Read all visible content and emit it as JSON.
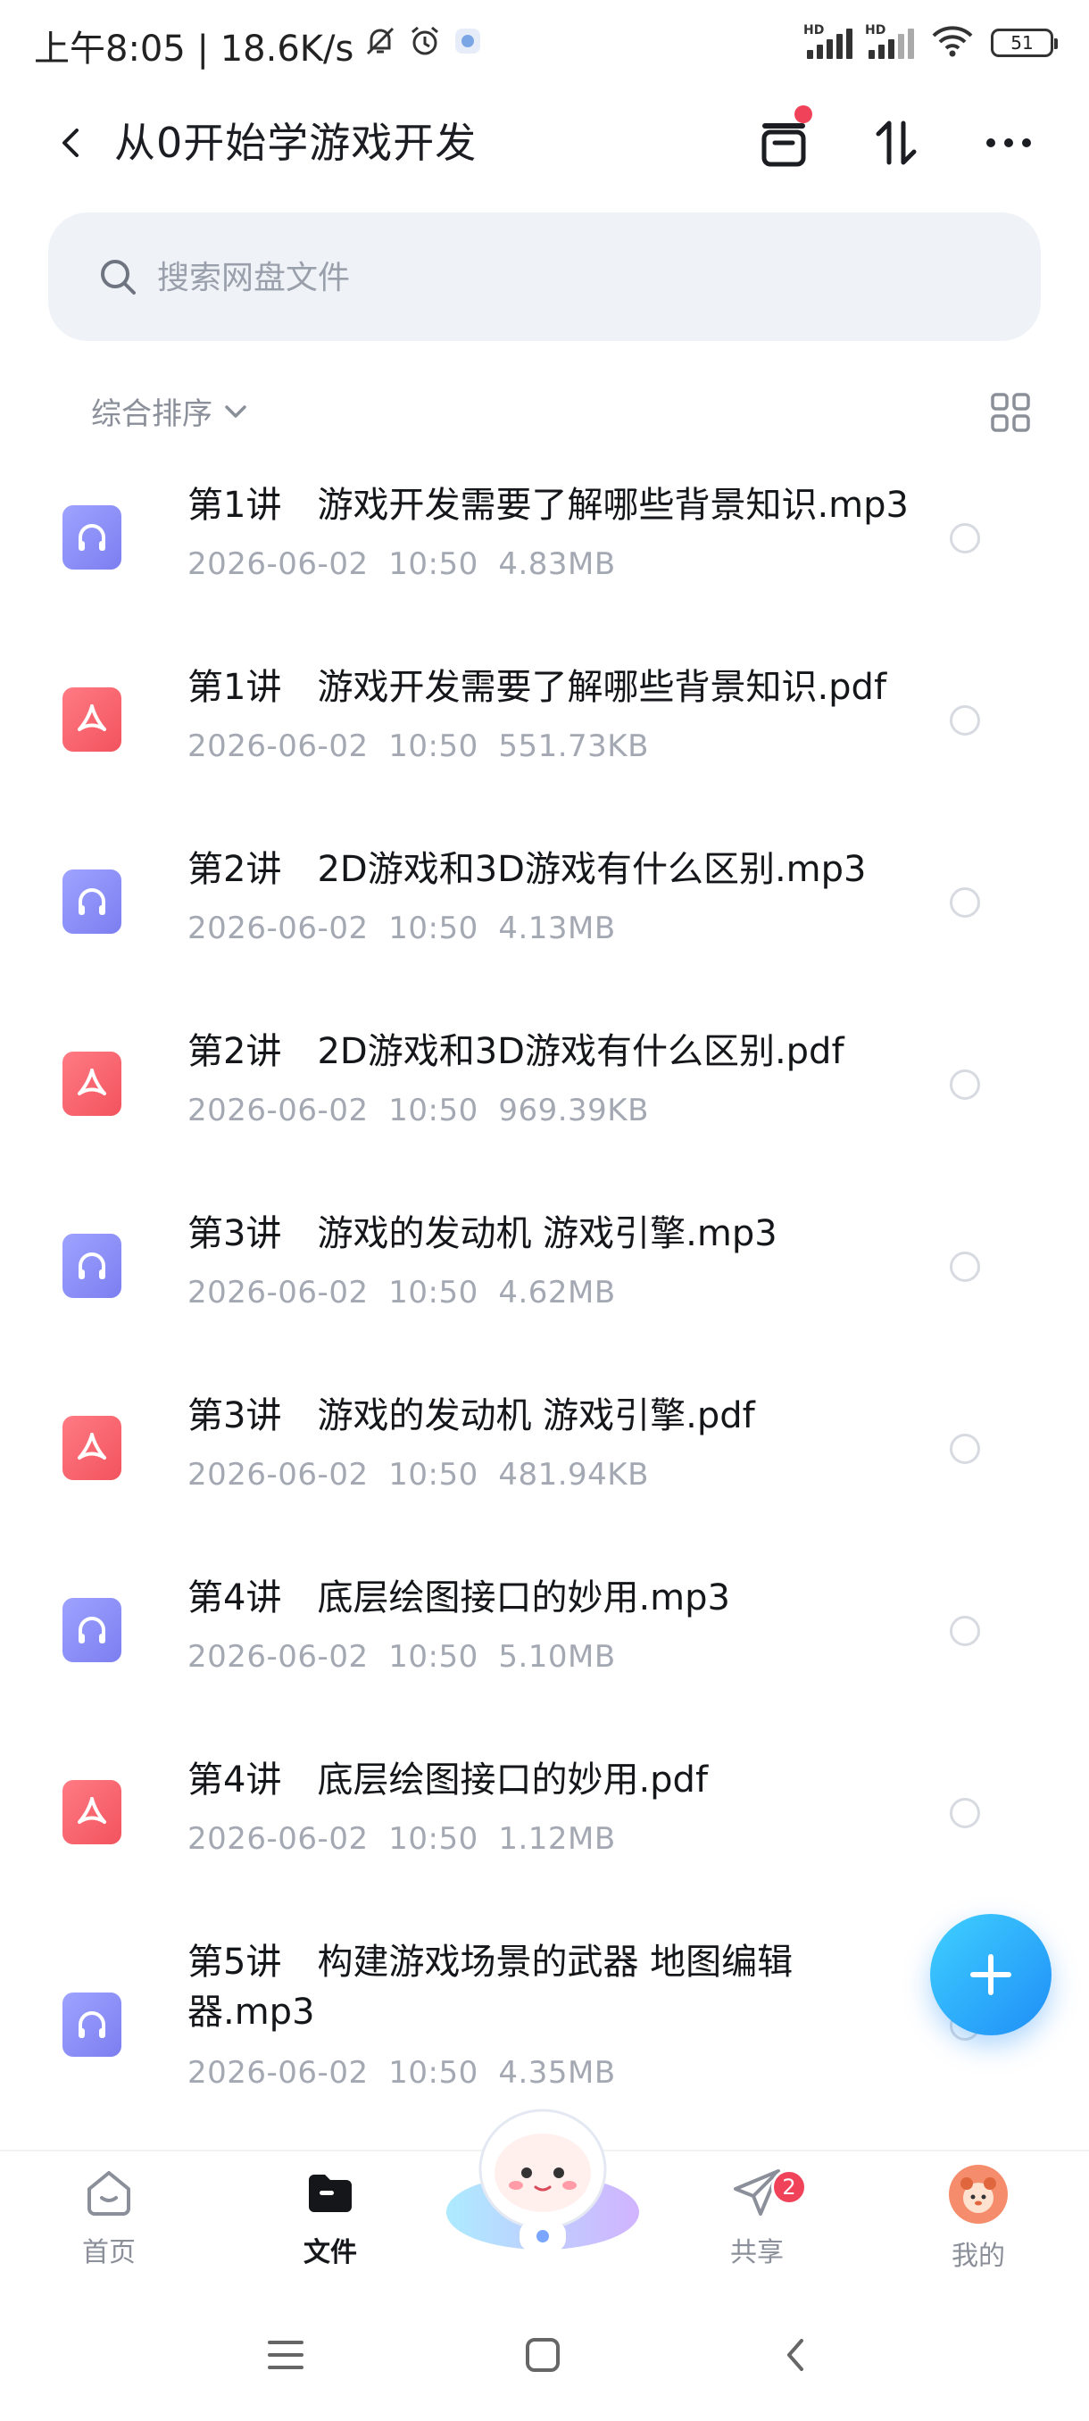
{
  "status_bar": {
    "time_speed": "上午8:05 | 18.6K/s",
    "battery": "51"
  },
  "header": {
    "title": "从0开始学游戏开发"
  },
  "search": {
    "placeholder": "搜索网盘文件"
  },
  "toolbar": {
    "sort_label": "综合排序"
  },
  "files": [
    {
      "name": "第1讲　游戏开发需要了解哪些背景知识.mp3",
      "date": "2026-06-02",
      "time": "10:50",
      "size": "4.83MB",
      "type": "audio"
    },
    {
      "name": "第1讲　游戏开发需要了解哪些背景知识.pdf",
      "date": "2026-06-02",
      "time": "10:50",
      "size": "551.73KB",
      "type": "pdf"
    },
    {
      "name": "第2讲　2D游戏和3D游戏有什么区别.mp3",
      "date": "2026-06-02",
      "time": "10:50",
      "size": "4.13MB",
      "type": "audio"
    },
    {
      "name": "第2讲　2D游戏和3D游戏有什么区别.pdf",
      "date": "2026-06-02",
      "time": "10:50",
      "size": "969.39KB",
      "type": "pdf"
    },
    {
      "name": "第3讲　游戏的发动机 游戏引擎.mp3",
      "date": "2026-06-02",
      "time": "10:50",
      "size": "4.62MB",
      "type": "audio"
    },
    {
      "name": "第3讲　游戏的发动机 游戏引擎.pdf",
      "date": "2026-06-02",
      "time": "10:50",
      "size": "481.94KB",
      "type": "pdf"
    },
    {
      "name": "第4讲　底层绘图接口的妙用.mp3",
      "date": "2026-06-02",
      "time": "10:50",
      "size": "5.10MB",
      "type": "audio"
    },
    {
      "name": "第4讲　底层绘图接口的妙用.pdf",
      "date": "2026-06-02",
      "time": "10:50",
      "size": "1.12MB",
      "type": "pdf"
    },
    {
      "name": "第5讲　构建游戏场景的武器 地图编辑器.mp3",
      "date": "2026-06-02",
      "time": "10:50",
      "size": "4.35MB",
      "type": "audio"
    }
  ],
  "bottom_nav": {
    "items": [
      {
        "label": "首页",
        "icon": "home-icon"
      },
      {
        "label": "文件",
        "icon": "folder-icon",
        "active": true
      },
      {
        "label": "共享",
        "icon": "share-icon",
        "badge": "2"
      },
      {
        "label": "我的",
        "icon": "avatar"
      }
    ]
  },
  "colors": {
    "accent": "#1f8ef7",
    "audio_icon": "#8a8cf5",
    "pdf_icon": "#f45d66",
    "badge": "#f0435a"
  }
}
